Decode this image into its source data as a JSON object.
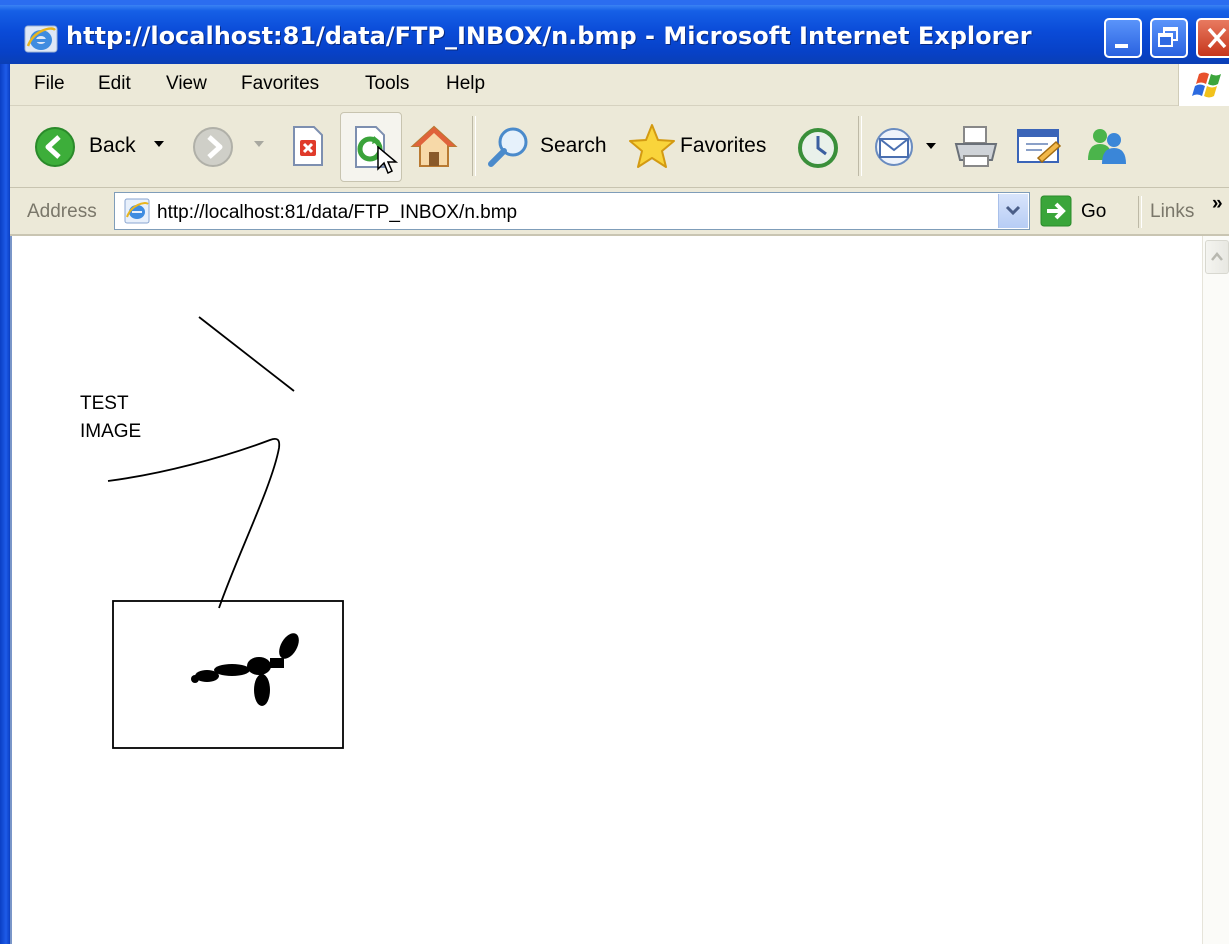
{
  "window": {
    "title": "http://localhost:81/data/FTP_INBOX/n.bmp - Microsoft Internet Explorer"
  },
  "menu": {
    "items": [
      "File",
      "Edit",
      "View",
      "Favorites",
      "Tools",
      "Help"
    ]
  },
  "toolbar": {
    "back_label": "Back",
    "search_label": "Search",
    "favorites_label": "Favorites"
  },
  "address_bar": {
    "label": "Address",
    "url": "http://localhost:81/data/FTP_INBOX/n.bmp",
    "go_label": "Go",
    "links_label": "Links",
    "links_chevron": "»"
  },
  "content": {
    "image_text": [
      "TEST",
      "IMAGE"
    ]
  },
  "colors": {
    "titlebar": "#0a4bd8",
    "chrome": "#ece9d8"
  }
}
